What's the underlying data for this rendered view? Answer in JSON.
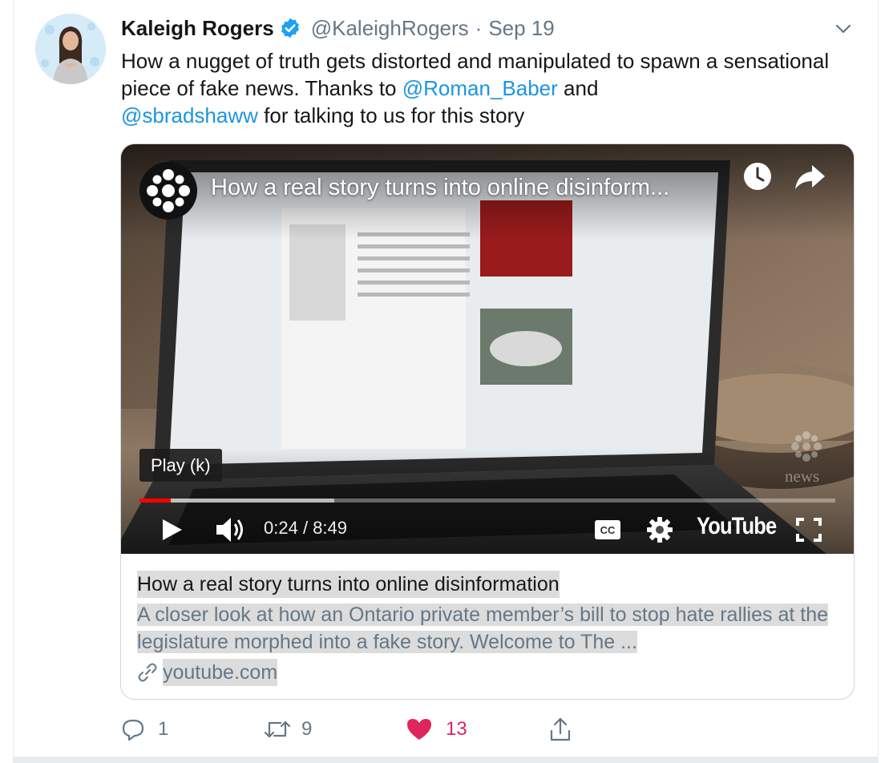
{
  "tweet": {
    "display_name": "Kaleigh Rogers",
    "handle": "@KaleighRogers",
    "separator": "·",
    "date": "Sep 19",
    "text_part1": "How a nugget of truth gets distorted and manipulated to spawn a sensational piece of fake news. Thanks to ",
    "mention1": "@Roman_Baber",
    "text_part2": " and ",
    "mention2": "@sbradshaww",
    "text_part3": " for talking to us for this story"
  },
  "video": {
    "title": "How a real story turns into online disinform...",
    "tooltip": "Play (k)",
    "current_time": "0:24",
    "time_separator": " / ",
    "duration": "8:49",
    "played_fraction": 0.045,
    "loaded_fraction": 0.28,
    "platform_label": "YouTube",
    "watermark": "news",
    "icons": [
      "cbc-logo-icon",
      "clock-icon",
      "share-icon",
      "play-icon",
      "volume-icon",
      "cc-icon",
      "settings-icon",
      "fullscreen-icon"
    ]
  },
  "card": {
    "title": "How a real story turns into online disinformation",
    "description": "A closer look at how an Ontario private member’s bill to stop hate rallies at the legislature morphed into a fake story. Welcome to The ...",
    "domain": "youtube.com"
  },
  "actions": {
    "reply_count": "1",
    "retweet_count": "9",
    "like_count": "13"
  },
  "colors": {
    "link": "#1b95e0",
    "like": "#e0245e",
    "muted": "#657786",
    "progress": "#ff0000"
  }
}
